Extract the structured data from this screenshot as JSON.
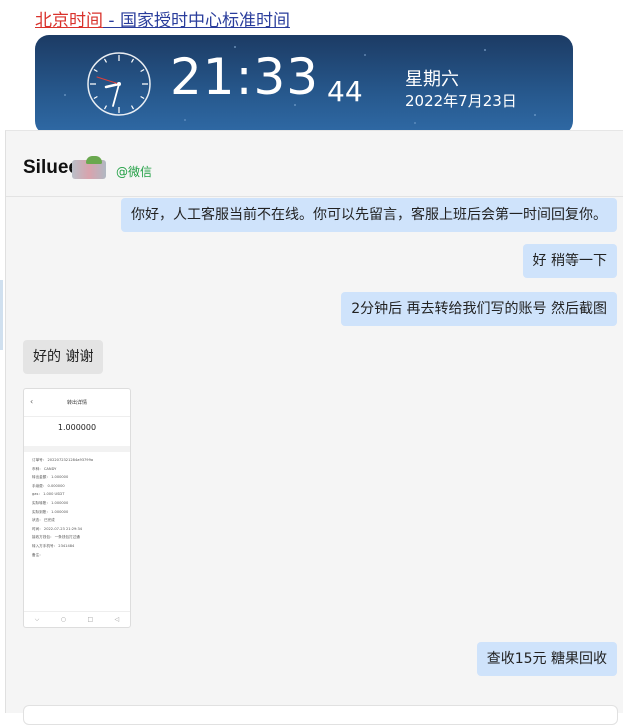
{
  "top_link": {
    "part1": "北京时间",
    "part2": " - 国家授时中心标准时间",
    "color_part1": "#d9322c",
    "color_part2": "#2a3d9c"
  },
  "clock": {
    "time": "21:33",
    "seconds": "44",
    "weekday": "星期六",
    "date": "2022年7月23日"
  },
  "chat": {
    "contact_name": "Siluee",
    "contact_tag": "@微信",
    "messages": [
      {
        "side": "right",
        "text": "你好，人工客服当前不在线。你可以先留言，客服上班后会第一时间回复你。"
      },
      {
        "side": "right",
        "text": "好 稍等一下"
      },
      {
        "side": "right",
        "text": "2分钟后  再去转给我们写的账号    然后截图"
      },
      {
        "side": "left",
        "text": "好的 谢谢"
      },
      {
        "side": "left",
        "type": "image"
      },
      {
        "side": "right",
        "text": "查收15元  糖果回收"
      }
    ],
    "image": {
      "title": "转出详情",
      "amount": "1.000000",
      "rows": [
        "订单号：  2022072321284a93799a",
        "币种：  CANDY",
        "转出金额：  1.000000",
        "手续费：  0.000000",
        "gas：  1.000 USDT",
        "实际转账：  1.000000",
        "实际到账：  1.000000",
        "状态：  已完成",
        "时间：  2022-07-23 21:29:34",
        "接收方钱包：  一条钱包打过通",
        "转入方手机号：  2341484",
        "备注："
      ]
    }
  },
  "colors": {
    "banner_top": "#1c3b64",
    "banner_bottom": "#2f6aa6",
    "bubble_right": "#cfe3fb",
    "bubble_left": "#e4e4e4",
    "tag_green": "#22a045"
  }
}
